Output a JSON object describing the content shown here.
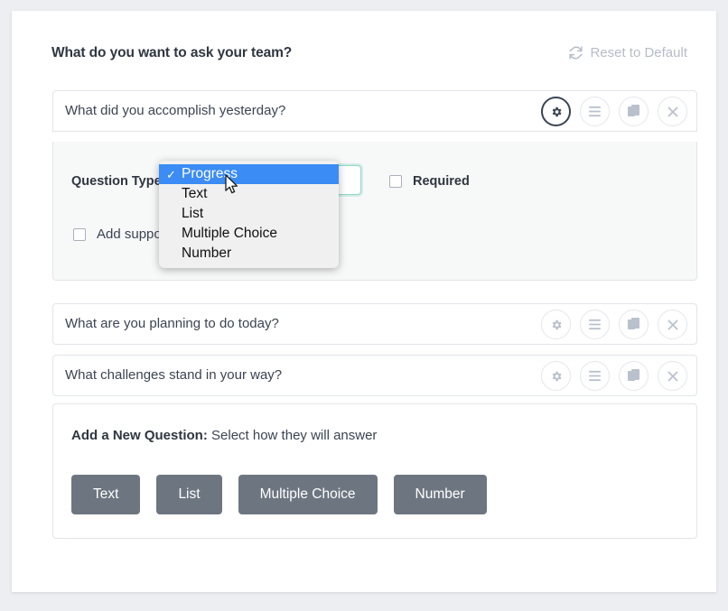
{
  "header": {
    "title": "What do you want to ask your team?",
    "reset_label": "Reset to Default",
    "reset_icon": "refresh-icon"
  },
  "questions": [
    {
      "text": "What did you accomplish yesterday?",
      "active": true,
      "icons": [
        "gear-icon",
        "list-icon",
        "copy-icon",
        "close-icon"
      ]
    },
    {
      "text": "What are you planning to do today?",
      "active": false,
      "icons": [
        "gear-icon",
        "list-icon",
        "copy-icon",
        "close-icon"
      ]
    },
    {
      "text": "What challenges stand in your way?",
      "active": false,
      "icons": [
        "gear-icon",
        "list-icon",
        "copy-icon",
        "close-icon"
      ]
    }
  ],
  "settings": {
    "question_type_label": "Question Type",
    "question_type_value": "Progress",
    "required_label": "Required",
    "required_checked": false,
    "add_support_label": "Add suppor",
    "add_support_checked": false
  },
  "dropdown": {
    "open": true,
    "selected": "Progress",
    "check_glyph": "✓",
    "options": [
      "Progress",
      "Text",
      "List",
      "Multiple Choice",
      "Number"
    ]
  },
  "add_new": {
    "title_bold": "Add a New Question:",
    "title_rest": " Select how they will answer",
    "buttons": [
      "Text",
      "List",
      "Multiple Choice",
      "Number"
    ]
  },
  "colors": {
    "page_background": "#eceef1",
    "card_background": "#ffffff",
    "panel_background": "#f7f8f8",
    "border": "#e2e5ea",
    "text_primary": "#2f3640",
    "text_secondary": "#3b4452",
    "muted": "#b6bcc8",
    "dropdown_highlight": "#3b8cf4",
    "dropdown_background": "#f0f0f0",
    "select_focus": "#8fd8c6",
    "button_gray": "#6d7680"
  }
}
